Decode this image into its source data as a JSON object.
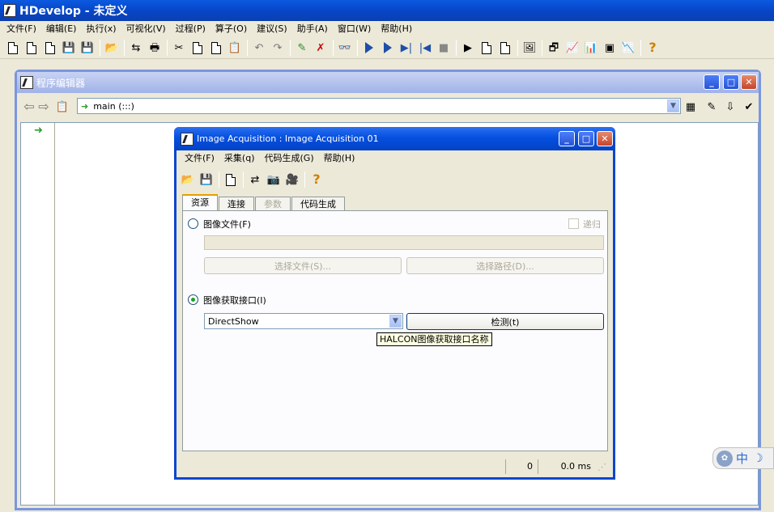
{
  "app": {
    "title": "HDevelop - 未定义",
    "menu": [
      "文件(F)",
      "编辑(E)",
      "执行(x)",
      "可视化(V)",
      "过程(P)",
      "算子(O)",
      "建议(S)",
      "助手(A)",
      "窗口(W)",
      "帮助(H)"
    ]
  },
  "editor": {
    "title": "程序编辑器",
    "procedure": "main (:::)"
  },
  "dialog": {
    "title": "Image Acquisition : Image Acquisition 01",
    "menu": [
      "文件(F)",
      "采集(q)",
      "代码生成(G)",
      "帮助(H)"
    ],
    "tabs": [
      "资源",
      "连接",
      "参数",
      "代码生成"
    ],
    "image_files_label": "图像文件(F)",
    "recursive_label": "递归",
    "choose_file": "选择文件(S)...",
    "choose_path": "选择路径(D)...",
    "acq_interface_label": "图像获取接口(I)",
    "interface_value": "DirectShow",
    "detect_button": "检测(t)",
    "tooltip": "HALCON图像获取接口名称",
    "status_count": "0",
    "status_time": "0.0 ms"
  },
  "ime": {
    "mode": "中"
  }
}
